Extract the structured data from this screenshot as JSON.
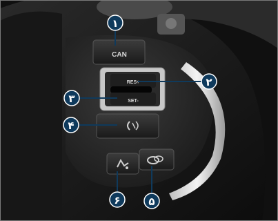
{
  "buttons": {
    "cancel_label": "CAN",
    "resume_label": "RES+",
    "set_label": "SET-"
  },
  "callouts": {
    "c1": "۱",
    "c2": "۲",
    "c3": "۳",
    "c4": "۴",
    "c5": "۵",
    "c6": "۶"
  },
  "colors": {
    "callout_fill": "#0f3a5c",
    "frame_border": "#7a7a7a"
  },
  "icons": {
    "distance_button": "car-distance-icon",
    "lane_button": "lane-assist-icon",
    "stalk_button": "steering-wheel-icon"
  }
}
